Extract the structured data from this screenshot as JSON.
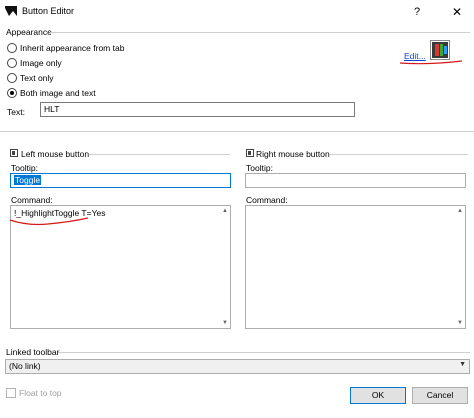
{
  "window": {
    "title": "Button Editor",
    "help_icon": "?",
    "close_icon": "✕"
  },
  "appearance": {
    "section_label": "Appearance",
    "options": [
      {
        "label": "Inherit appearance from tab",
        "checked": false
      },
      {
        "label": "Image only",
        "checked": false
      },
      {
        "label": "Text only",
        "checked": false
      },
      {
        "label": "Both image and text",
        "checked": true
      }
    ],
    "edit_link": "Edit...",
    "text_label": "Text:",
    "text_value": "HLT"
  },
  "left_button": {
    "section_label": "Left mouse button",
    "tooltip_label": "Tooltip:",
    "tooltip_value": "Toggle",
    "command_label": "Command:",
    "command_value": "!_HighlightToggle T=Yes"
  },
  "right_button": {
    "section_label": "Right mouse button",
    "tooltip_label": "Tooltip:",
    "tooltip_value": "",
    "command_label": "Command:",
    "command_value": ""
  },
  "linked_toolbar": {
    "section_label": "Linked toolbar",
    "selected": "(No link)"
  },
  "footer": {
    "float_to_top": "Float to top",
    "ok": "OK",
    "cancel": "Cancel"
  },
  "colors": {
    "accent": "#0078d7",
    "annotation": "#d31a1a",
    "link": "#0b3fd6"
  }
}
